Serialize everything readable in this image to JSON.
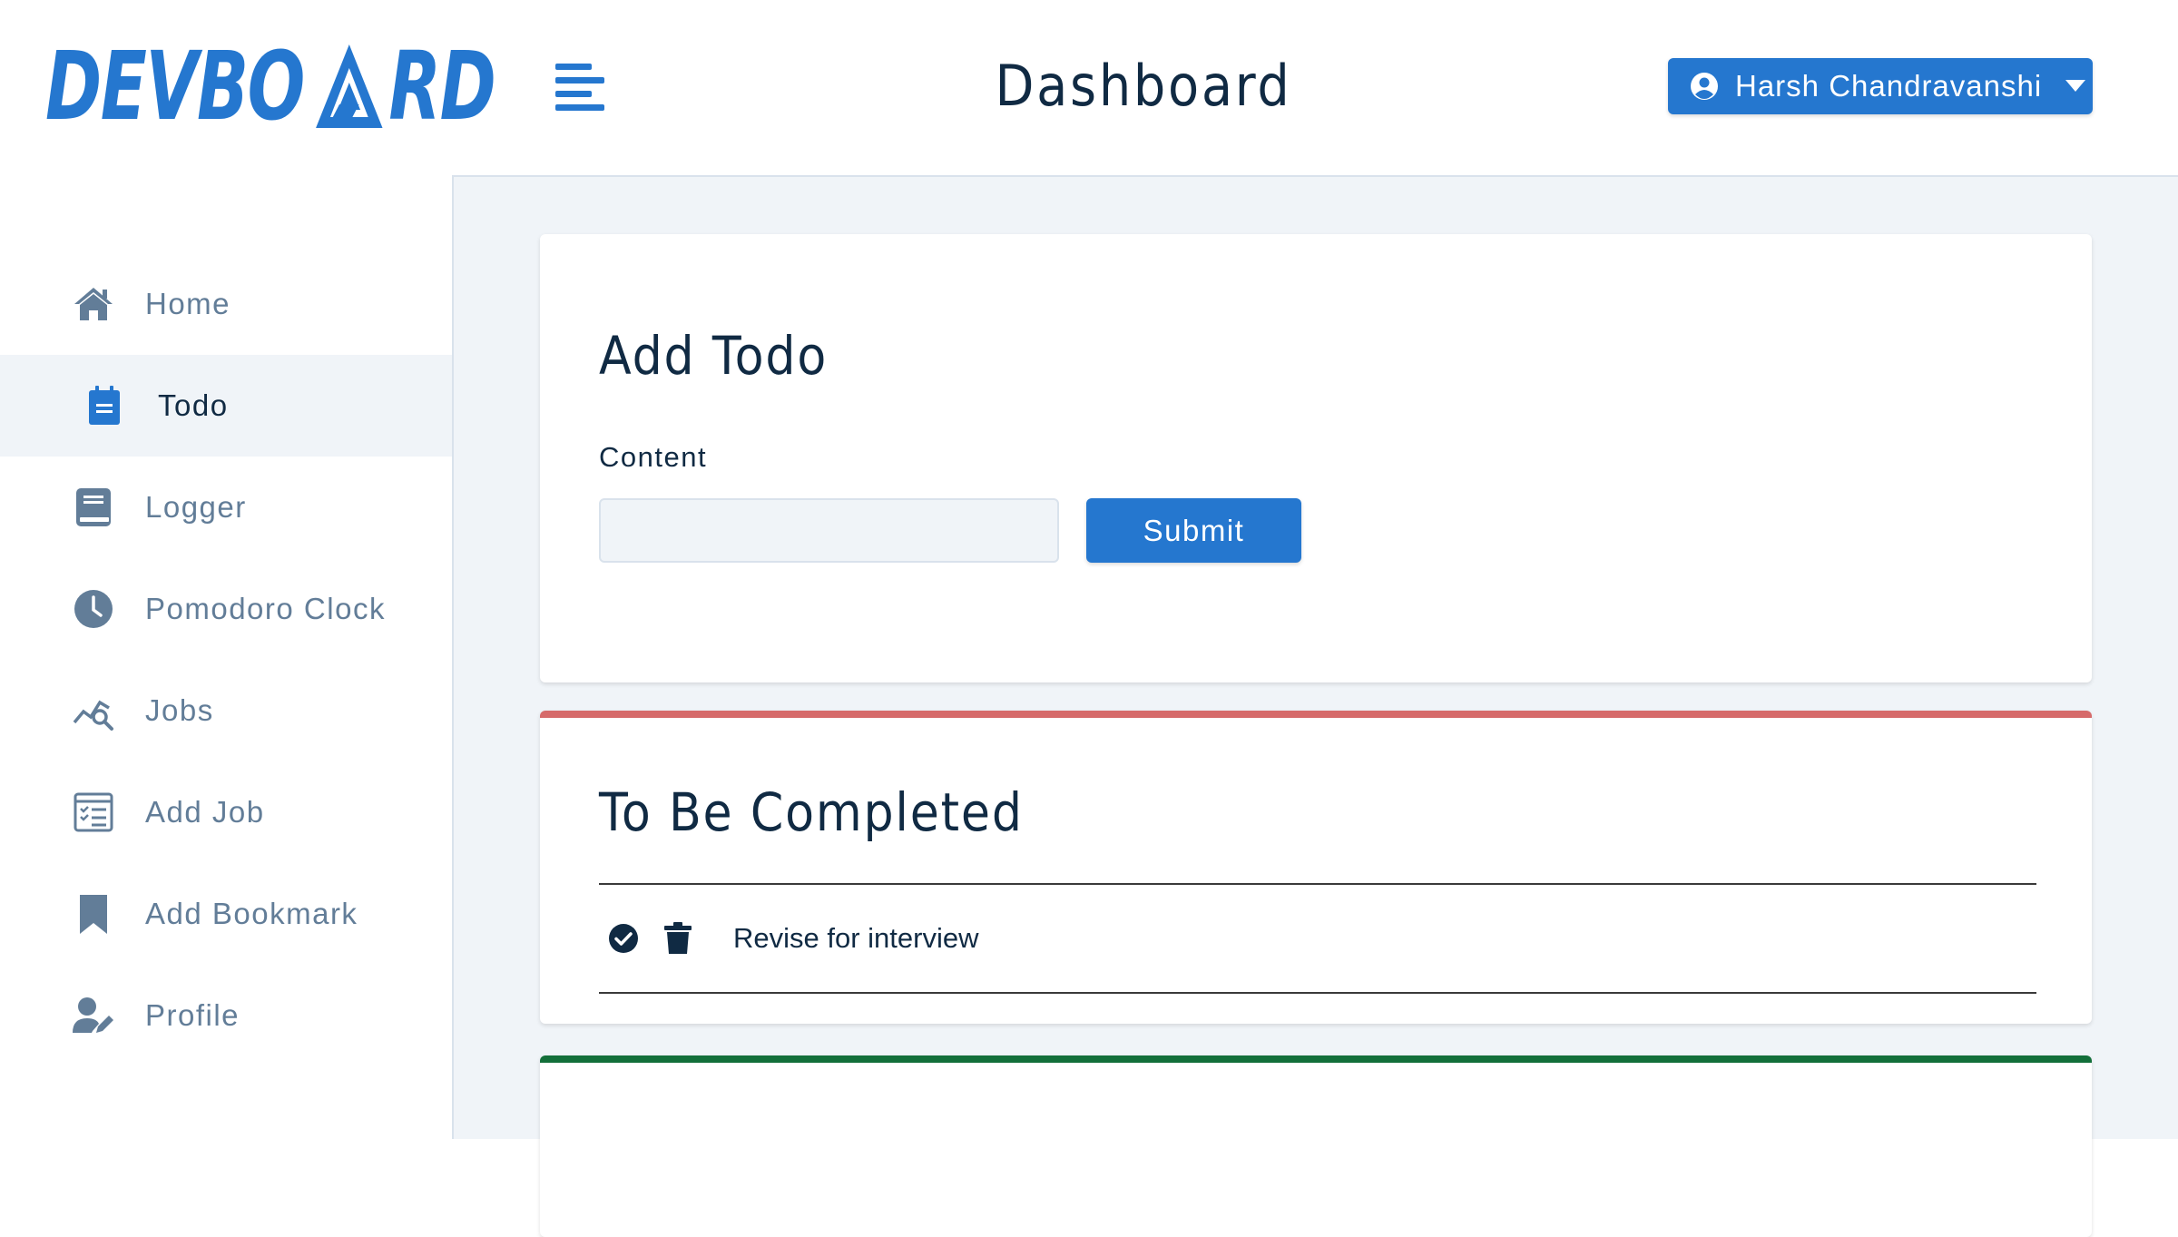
{
  "header": {
    "logo_left": "DEVBO",
    "logo_right": "RD",
    "title": "Dashboard",
    "user_name": "Harsh Chandravanshi"
  },
  "sidebar": {
    "items": [
      {
        "label": "Home",
        "icon": "home-icon"
      },
      {
        "label": "Todo",
        "icon": "clipboard-icon",
        "active": true
      },
      {
        "label": "Logger",
        "icon": "book-icon"
      },
      {
        "label": "Pomodoro Clock",
        "icon": "clock-icon"
      },
      {
        "label": "Jobs",
        "icon": "chart-search-icon"
      },
      {
        "label": "Add Job",
        "icon": "form-icon"
      },
      {
        "label": "Add Bookmark",
        "icon": "bookmark-icon"
      },
      {
        "label": "Profile",
        "icon": "user-edit-icon"
      }
    ]
  },
  "add_todo": {
    "title": "Add Todo",
    "content_label": "Content",
    "content_value": "",
    "submit_label": "Submit"
  },
  "pending": {
    "title": "To Be Completed",
    "items": [
      {
        "text": "Revise for interview"
      }
    ]
  },
  "colors": {
    "accent": "#2577cf",
    "pending_border": "#d66a6a",
    "completed_border": "#136f3a",
    "main_background": "#f0f4f8"
  }
}
